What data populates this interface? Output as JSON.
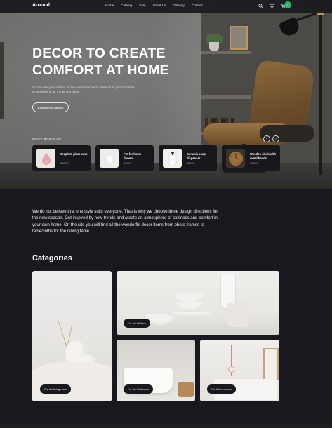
{
  "brand": {
    "logo": "Around"
  },
  "nav": {
    "items": [
      "Home",
      "Catalog",
      "Sale",
      "About Us",
      "Delivery",
      "Contact"
    ],
    "icons": [
      "search-icon",
      "heart-icon",
      "cart-icon"
    ],
    "cart_count": "4"
  },
  "hero": {
    "title": "DECOR TO CREATE COMFORT AT HOME",
    "subtitle": "On the site you will find all the wonderful decor items from photo frames to tablecloths for the dining table",
    "cta": "Explore the catalog",
    "popular_label": "MOST POPULAR",
    "prev_arrow": "‹",
    "next_arrow": "›"
  },
  "popular": [
    {
      "name": "Graphite glass vase",
      "price": "$18.00",
      "icon": "vase-icon"
    },
    {
      "name": "Pot for home flowers",
      "price": "$11.00",
      "icon": "pot-icon"
    },
    {
      "name": "Ceramic soap dispenser",
      "price": "$33.00",
      "icon": "soap-dispenser-icon"
    },
    {
      "name": "Wooden clock with metal hands",
      "price": "$43.00",
      "icon": "clock-icon"
    }
  ],
  "about": {
    "text": "We do not believe that one style suits everyone. That is why we choose three design directions for the new season. Get inspired by new trends and create an atmosphere of coziness and comfort in your own home. On the site you will find all the wonderful decor items from photo frames to tablecloths for the dining table"
  },
  "categories": {
    "title": "Categories",
    "items": [
      {
        "label": "For the living room"
      },
      {
        "label": "For the kitchen"
      },
      {
        "label": "For the bathroom"
      },
      {
        "label": "For the bedroom"
      }
    ]
  },
  "colors": {
    "background": "#17191e",
    "accent": "#2bb673"
  }
}
